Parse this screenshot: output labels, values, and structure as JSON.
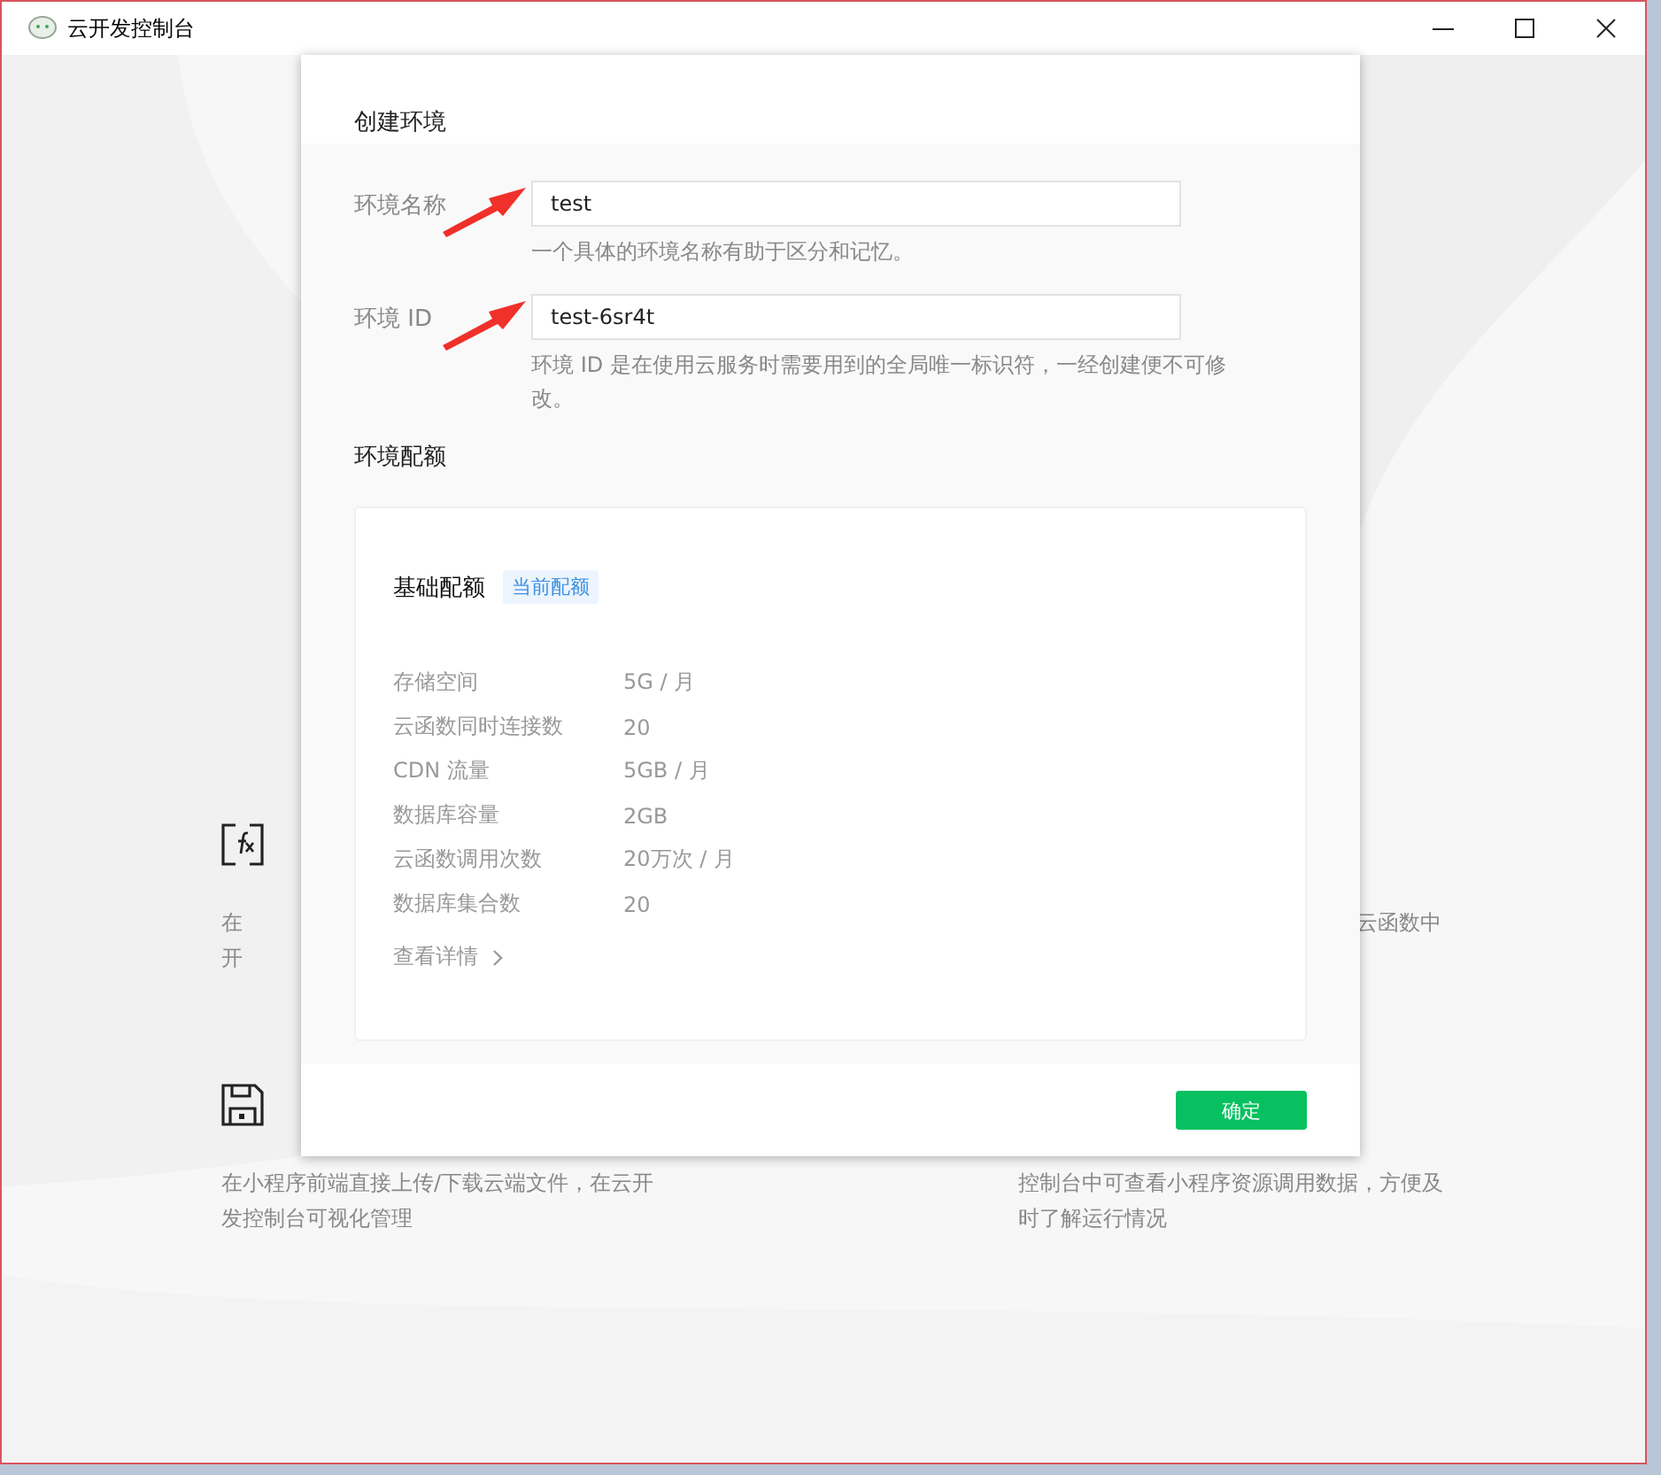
{
  "window": {
    "title": "云开发控制台"
  },
  "background": {
    "left": [
      {
        "kind": "functions",
        "lines": [
          "在",
          "开"
        ]
      },
      {
        "kind": "storage",
        "lines": [
          "在小程序前端直接上传/下载云端文件，在云开",
          "发控制台可视化管理"
        ]
      }
    ],
    "right": [
      {
        "lines": [
          "云函数中"
        ]
      },
      {
        "lines": [
          "控制台中可查看小程序资源调用数据，方便及",
          "时了解运行情况"
        ]
      }
    ]
  },
  "dialog": {
    "title": "创建环境",
    "fields": [
      {
        "label": "环境名称",
        "value": "test",
        "hint": "一个具体的环境名称有助于区分和记忆。"
      },
      {
        "label": "环境 ID",
        "value": "test-6sr4t",
        "hint": "环境 ID 是在使用云服务时需要用到的全局唯一标识符，一经创建便不可修改。"
      }
    ],
    "quota": {
      "title": "环境配额",
      "plan": "基础配额",
      "tag": "当前配额",
      "rows": [
        {
          "name": "存储空间",
          "value": "5G / 月"
        },
        {
          "name": "云函数同时连接数",
          "value": "20"
        },
        {
          "name": "CDN 流量",
          "value": "5GB / 月"
        },
        {
          "name": "数据库容量",
          "value": "2GB"
        },
        {
          "name": "云函数调用次数",
          "value": "20万次 / 月"
        },
        {
          "name": "数据库集合数",
          "value": "20"
        }
      ],
      "details_link": "查看详情"
    },
    "confirm_button": "确定"
  }
}
